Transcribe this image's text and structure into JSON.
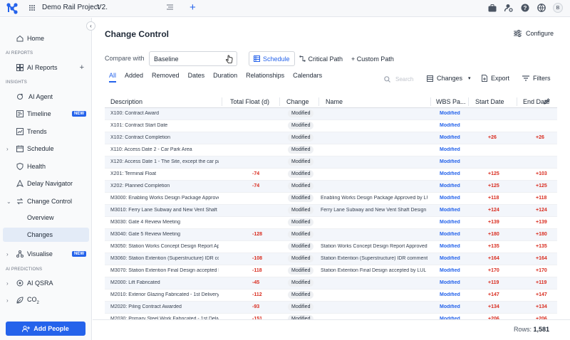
{
  "topbar": {
    "project": "Demo Rail Project",
    "separator": "›",
    "version": "V2.",
    "avatar_initial": "B"
  },
  "sidebar": {
    "home": "Home",
    "section_reports": "AI REPORTS",
    "ai_reports": "AI Reports",
    "section_insights": "INSIGHTS",
    "ai_agent": "AI Agent",
    "timeline": "Timeline",
    "timeline_badge": "NEW",
    "trends": "Trends",
    "schedule": "Schedule",
    "health": "Health",
    "delay_navigator": "Delay Navigator",
    "change_control": "Change Control",
    "overview": "Overview",
    "changes": "Changes",
    "visualise": "Visualise",
    "visualise_badge": "NEW",
    "section_predictions": "AI PREDICTIONS",
    "ai_qsra": "AI QSRA",
    "co2": "CO",
    "co2_sub": "2",
    "add_people": "Add People"
  },
  "main": {
    "title": "Change Control",
    "configure": "Configure",
    "compare_label": "Compare with",
    "compare_value": "Baseline",
    "view_tabs": [
      "Schedule",
      "Critical Path",
      "+ Custom Path"
    ],
    "filter_tabs": [
      "All",
      "Added",
      "Removed",
      "Dates",
      "Duration",
      "Relationships",
      "Calendars"
    ],
    "search_placeholder": "Search",
    "changes_btn": "Changes",
    "export_btn": "Export",
    "filters_btn": "Filters"
  },
  "table": {
    "columns": [
      "Description",
      "Total Float (d)",
      "Change",
      "Name",
      "WBS Pa...",
      "Start Date",
      "End Date"
    ],
    "rows": [
      {
        "description": "X100: Contract Award",
        "float": "",
        "change": "Modified",
        "name": "",
        "wbs": "Modified",
        "start": "",
        "end": ""
      },
      {
        "description": "X101: Contract Start Date",
        "float": "",
        "change": "Modified",
        "name": "",
        "wbs": "Modified",
        "start": "",
        "end": ""
      },
      {
        "description": "X102: Contract Completion",
        "float": "",
        "change": "Modified",
        "name": "",
        "wbs": "Modified",
        "start": "+26",
        "end": "+26"
      },
      {
        "description": "X110: Access Date 2 - Car Park Area",
        "float": "",
        "change": "Modified",
        "name": "",
        "wbs": "Modified",
        "start": "",
        "end": ""
      },
      {
        "description": "X120: Access Date 1 - The Site, except the car park",
        "float": "",
        "change": "Modified",
        "name": "",
        "wbs": "Modified",
        "start": "",
        "end": ""
      },
      {
        "description": "X201: Terminal Float",
        "float": "-74",
        "change": "Modified",
        "name": "",
        "wbs": "Modified",
        "start": "+125",
        "end": "+103"
      },
      {
        "description": "X202: Planned Completion",
        "float": "-74",
        "change": "Modified",
        "name": "",
        "wbs": "Modified",
        "start": "+125",
        "end": "+125"
      },
      {
        "description": "M3000: Enabling Works Design Package Approved",
        "float": "",
        "change": "Modified",
        "name": "Enabling Works Design Package Approved by LUL",
        "wbs": "Modified",
        "start": "+118",
        "end": "+118"
      },
      {
        "description": "M3010: Ferry Lane Subway and New Vent Shaft Design",
        "float": "",
        "change": "Modified",
        "name": "Ferry Lane Subway and New Vent Shaft Design Package",
        "wbs": "Modified",
        "start": "+124",
        "end": "+124"
      },
      {
        "description": "M3030: Gate 4 Review Meeting",
        "float": "",
        "change": "Modified",
        "name": "",
        "wbs": "Modified",
        "start": "+139",
        "end": "+139"
      },
      {
        "description": "M3040: Gate 5 Review Meeting",
        "float": "-128",
        "change": "Modified",
        "name": "",
        "wbs": "Modified",
        "start": "+180",
        "end": "+180"
      },
      {
        "description": "M3050: Station Works Concept Design Report Approved",
        "float": "",
        "change": "Modified",
        "name": "Station Works Concept Design Report Approved by",
        "wbs": "Modified",
        "start": "+135",
        "end": "+135"
      },
      {
        "description": "M3060: Station Extention (Superstructure) IDR comments",
        "float": "-108",
        "change": "Modified",
        "name": "Station Extention (Superstructure) IDR comments",
        "wbs": "Modified",
        "start": "+164",
        "end": "+164"
      },
      {
        "description": "M3070: Station Extention Final Design accepted by LUL",
        "float": "-118",
        "change": "Modified",
        "name": "Station Extention Final Design accepted by LUL",
        "wbs": "Modified",
        "start": "+170",
        "end": "+170"
      },
      {
        "description": "M2000: Lift Fabricated",
        "float": "-45",
        "change": "Modified",
        "name": "",
        "wbs": "Modified",
        "start": "+119",
        "end": "+119"
      },
      {
        "description": "M2010: Exterior Glazing Fabricated - 1st Delivery",
        "float": "-112",
        "change": "Modified",
        "name": "",
        "wbs": "Modified",
        "start": "+147",
        "end": "+147"
      },
      {
        "description": "M2020: Piling Contract Awarded",
        "float": "-93",
        "change": "Modified",
        "name": "",
        "wbs": "Modified",
        "start": "+134",
        "end": "+134"
      },
      {
        "description": "M2030: Primary Steel Work Fabricated - 1st Delivery",
        "float": "-151",
        "change": "Modified",
        "name": "",
        "wbs": "Modified",
        "start": "+206",
        "end": "+206"
      }
    ]
  },
  "footer": {
    "rows_label": "Rows:",
    "rows_value": "1,581"
  },
  "colors": {
    "accent": "#2563eb",
    "negative": "#d92d20",
    "active_bg": "#e3ebf7"
  }
}
